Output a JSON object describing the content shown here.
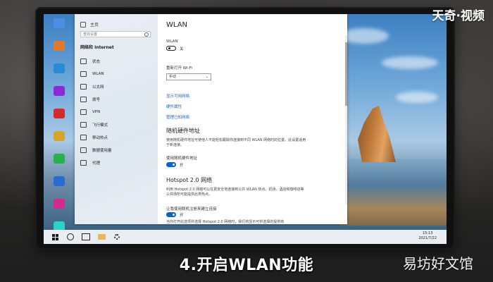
{
  "watermark_top": "天奇·视频",
  "caption": "4.开启WLAN功能",
  "watermark_bottom": "易坊好文馆",
  "desktop": {
    "icons": [
      {
        "label": "",
        "color": "#4a90e2"
      },
      {
        "label": "",
        "color": "#e07a2a"
      },
      {
        "label": "",
        "color": "#2a8ad4"
      },
      {
        "label": "",
        "color": "#8a2ad4"
      },
      {
        "label": "",
        "color": "#d42a2a"
      },
      {
        "label": "",
        "color": "#d4a52a"
      },
      {
        "label": "",
        "color": "#2ab04a"
      },
      {
        "label": "",
        "color": "#2a6ad4"
      },
      {
        "label": "",
        "color": "#d42a8a"
      },
      {
        "label": "",
        "color": "#2ad4c4"
      }
    ]
  },
  "settings": {
    "nav": {
      "home": "主页",
      "search_placeholder": "查找设置",
      "section": "网络和 Internet",
      "items": [
        {
          "label": "状态"
        },
        {
          "label": "WLAN"
        },
        {
          "label": "以太网"
        },
        {
          "label": "拨号"
        },
        {
          "label": "VPN"
        },
        {
          "label": "飞行模式"
        },
        {
          "label": "移动热点"
        },
        {
          "label": "数据使用量"
        },
        {
          "label": "代理"
        }
      ]
    },
    "content": {
      "title": "WLAN",
      "wlan_label": "WLAN",
      "wlan_state": "关",
      "reopen_label": "重新打开 Wi-Fi",
      "reopen_value": "手动",
      "links": [
        "显示可用网络",
        "硬件属性",
        "管理已知网络"
      ],
      "random_hw": {
        "heading": "随机硬件地址",
        "desc": "使用随机硬件地址可使他人不能轻松跟踪你连接到不同 WLAN 网络时的位置。此设置适用于新连接。",
        "toggle_label": "使用随机硬件地址",
        "toggle_state": "开"
      },
      "hotspot": {
        "heading": "Hotspot 2.0 网络",
        "desc": "利用 Hotspot 2.0 网络可以在更安全地连接到公共 WLAN 热点。机场、酒店和咖啡店等公共场所可能提供此类热点。",
        "toggle_label": "让我使用联机注册来建立连接",
        "toggle_state": "开",
        "note": "当你打开此选项并选择 Hotspot 2.0 网络时，我们将显示可供选择的提供商"
      }
    }
  },
  "taskbar": {
    "time": "15:13",
    "date": "2021/7/22"
  }
}
